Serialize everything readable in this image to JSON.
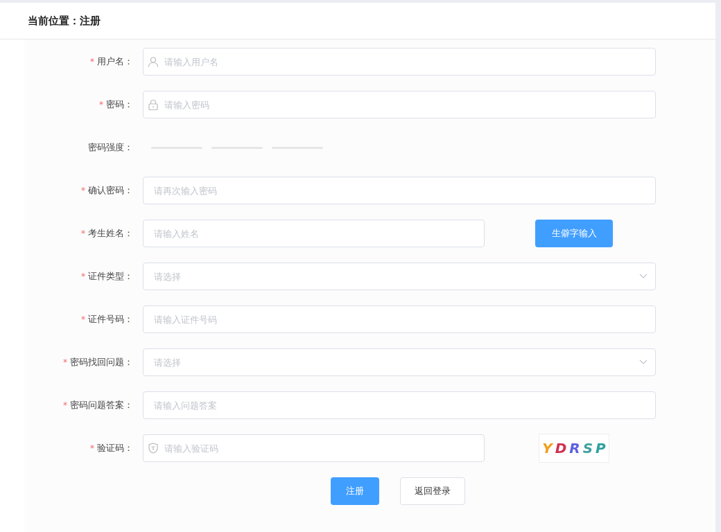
{
  "breadcrumb": "当前位置：注册",
  "fields": [
    {
      "kind": "user-input",
      "required_mark": "*",
      "label": "用户名：",
      "placeholder": "请输入用户名"
    },
    {
      "kind": "lock-input",
      "required_mark": "*",
      "label": "密码：",
      "placeholder": "请输入密码"
    },
    {
      "kind": "strength",
      "label": "密码强度：",
      "level": 0
    },
    {
      "kind": "input",
      "required_mark": "*",
      "label": "确认密码：",
      "placeholder": "请再次输入密码"
    },
    {
      "kind": "input-button",
      "required_mark": "*",
      "label": "考生姓名：",
      "placeholder": "请输入姓名",
      "button": "生僻字输入"
    },
    {
      "kind": "select",
      "required_mark": "*",
      "label": "证件类型：",
      "placeholder": "请选择"
    },
    {
      "kind": "input",
      "required_mark": "*",
      "label": "证件号码：",
      "placeholder": "请输入证件号码"
    },
    {
      "kind": "select",
      "required_mark": "*",
      "label": "密码找回问题：",
      "placeholder": "请选择"
    },
    {
      "kind": "input",
      "required_mark": "*",
      "label": "密码问题答案：",
      "placeholder": "请输入问题答案"
    },
    {
      "kind": "captcha",
      "required_mark": "*",
      "label": "验证码：",
      "placeholder": "请输入验证码",
      "captcha": "YDRSP"
    }
  ],
  "buttons": [
    {
      "label": "注册",
      "kind": "primary"
    },
    {
      "label": "返回登录",
      "kind": "default"
    }
  ]
}
